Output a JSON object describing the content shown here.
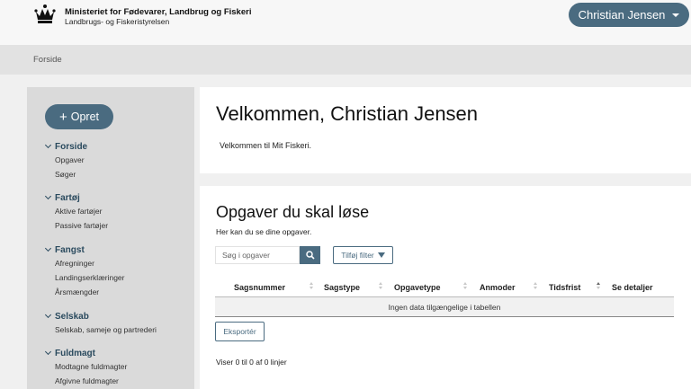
{
  "header": {
    "ministry": "Ministeriet for Fødevarer, Landbrug og Fiskeri",
    "agency": "Landbrugs- og Fiskeristyrelsen",
    "user_name": "Christian Jensen"
  },
  "breadcrumb": {
    "current": "Forside"
  },
  "sidebar": {
    "create_label": "Opret",
    "sections": [
      {
        "title": "Forside",
        "items": [
          "Opgaver",
          "Søger"
        ]
      },
      {
        "title": "Fartøj",
        "items": [
          "Aktive fartøjer",
          "Passive fartøjer"
        ]
      },
      {
        "title": "Fangst",
        "items": [
          "Afregninger",
          "Landingserklæringer",
          "Årsmængder"
        ]
      },
      {
        "title": "Selskab",
        "items": [
          "Selskab, sameje og partrederi"
        ]
      },
      {
        "title": "Fuldmagt",
        "items": [
          "Modtagne fuldmagter",
          "Afgivne fuldmagter"
        ]
      }
    ]
  },
  "welcome": {
    "title": "Velkommen, Christian Jensen",
    "text": "Velkommen til Mit Fiskeri."
  },
  "tasks": {
    "title": "Opgaver du skal løse",
    "subtitle": "Her kan du se dine opgaver.",
    "search_placeholder": "Søg i opgaver",
    "filter_label": "Tilføj filter",
    "columns": [
      "Sagsnummer",
      "Sagstype",
      "Opgavetype",
      "Anmoder",
      "Tidsfrist",
      "Se detaljer"
    ],
    "empty_text": "Ingen data tilgængelige i tabellen",
    "export_label": "Eksportér",
    "info": "Viser 0 til 0 af 0 linjer"
  },
  "colors": {
    "accent": "#4a6b80",
    "sidebar_bg": "#dadada",
    "page_bg": "#f0f0f0"
  }
}
